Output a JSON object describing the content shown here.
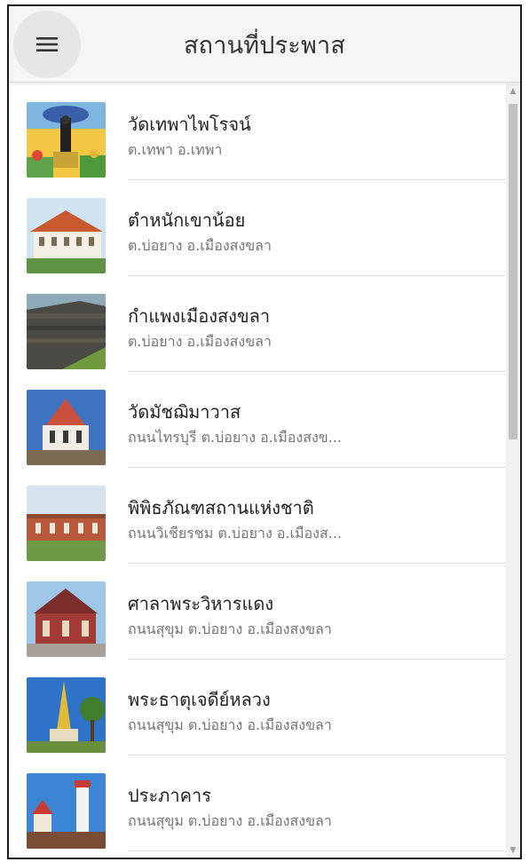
{
  "header": {
    "title": "สถานที่ประพาส",
    "menu_icon": "hamburger-menu-icon"
  },
  "places": [
    {
      "name": "วัดเทพาไพโรจน์",
      "address": "ต.เทพา อ.เทพา"
    },
    {
      "name": "ตำหนักเขาน้อย",
      "address": "ต.บ่อยาง อ.เมืองสงขลา"
    },
    {
      "name": "กำแพงเมืองสงขลา",
      "address": "ต.บ่อยาง อ.เมืองสงขลา"
    },
    {
      "name": "วัดมัชฌิมาวาส",
      "address": "ถนนไทรบุรี ต.บ่อยาง อ.เมืองสงข..."
    },
    {
      "name": "พิพิธภัณฑสถานแห่งชาติ",
      "address": "ถนนวิเชียรชม ต.บ่อยาง อ.เมืองส..."
    },
    {
      "name": "ศาลาพระวิหารแดง",
      "address": "ถนนสุขุม ต.บ่อยาง อ.เมืองสงขลา"
    },
    {
      "name": "พระธาตุเจดีย์หลวง",
      "address": "ถนนสุขุม ต.บ่อยาง อ.เมืองสงขลา"
    },
    {
      "name": "ประภาคาร",
      "address": "ถนนสุขุม ต.บ่อยาง อ.เมืองสงขลา"
    }
  ],
  "colors": {
    "appbar_bg": "#f5f5f5",
    "name_text": "#222222",
    "address_text": "#757575",
    "divider": "#dedede"
  }
}
